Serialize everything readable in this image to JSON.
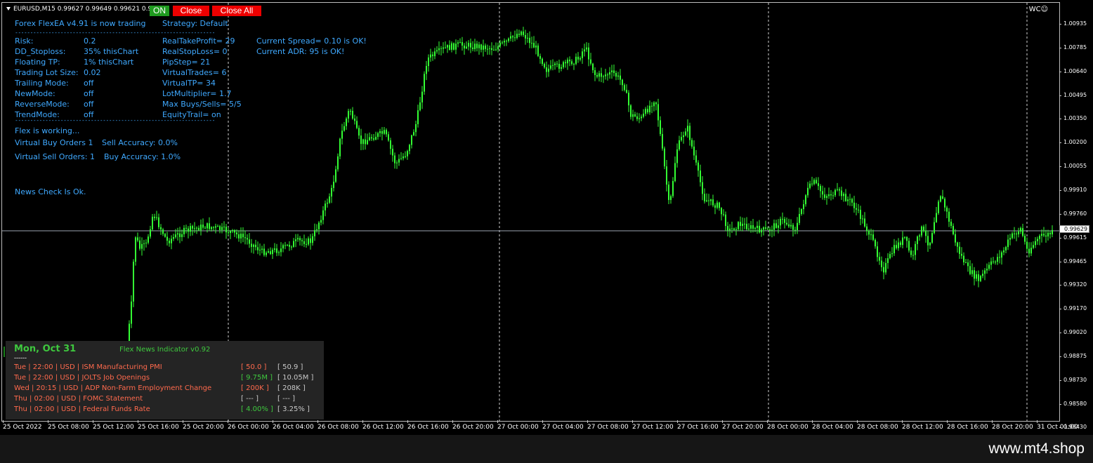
{
  "symbol_info": "EURUSD,M15  0.99627 0.99649 0.99621 0.99",
  "buttons": {
    "on": "ON",
    "close": "Close",
    "close_all": "Close All"
  },
  "wc_label": "WC",
  "ea_panel": {
    "trading_status": "Forex FlexEA v4.91 is now trading",
    "strategy": "Strategy: Default",
    "separator": "------------------------------------------------------------------",
    "rows": [
      {
        "label": "Risk:",
        "value": "0.2",
        "mid": "RealTakeProfit= 29",
        "right": "Current Spread= 0.10 is OK!"
      },
      {
        "label": "DD_Stoploss:",
        "value": "35%  thisChart",
        "mid": "RealStopLoss= 0",
        "right": "Current ADR: 95  is OK!"
      },
      {
        "label": "Floating TP:",
        "value": "1%  thisChart",
        "mid": "PipStep= 21",
        "right": ""
      },
      {
        "label": "Trading Lot Size:",
        "value": "0.02",
        "mid": "VirtualTrades= 6",
        "right": ""
      },
      {
        "label": "Trailing Mode:",
        "value": "off",
        "mid": "VirtualTP= 34",
        "right": ""
      },
      {
        "label": "NewMode:",
        "value": "off",
        "mid": "LotMultiplier= 1.7",
        "right": ""
      },
      {
        "label": "ReverseMode:",
        "value": "off",
        "mid": "Max Buys/Sells= 5/5",
        "right": ""
      },
      {
        "label": "TrendMode:",
        "value": "off",
        "mid": "EquityTrail= on",
        "right": ""
      }
    ],
    "working": "Flex is working...",
    "virtual_buy": "Virtual Buy Orders 1",
    "sell_accuracy": "Sell Accuracy: 0.0%",
    "virtual_sell": "Virtual Sell Orders: 1",
    "buy_accuracy": "Buy Accuracy: 1.0%",
    "news_check": "News Check Is Ok."
  },
  "price_axis": [
    "1.00935",
    "1.00785",
    "1.00640",
    "1.00495",
    "1.00350",
    "1.00200",
    "1.00055",
    "0.99910",
    "0.99760",
    "0.99615",
    "0.99465",
    "0.99320",
    "0.99170",
    "0.99020",
    "0.98875",
    "0.98730",
    "0.98580",
    "0.98430"
  ],
  "current_price": "0.99629",
  "time_axis": [
    "25 Oct 2022",
    "25 Oct 08:00",
    "25 Oct 12:00",
    "25 Oct 16:00",
    "25 Oct 20:00",
    "26 Oct 00:00",
    "26 Oct 04:00",
    "26 Oct 08:00",
    "26 Oct 12:00",
    "26 Oct 16:00",
    "26 Oct 20:00",
    "27 Oct 00:00",
    "27 Oct 04:00",
    "27 Oct 08:00",
    "27 Oct 12:00",
    "27 Oct 16:00",
    "27 Oct 20:00",
    "28 Oct 00:00",
    "28 Oct 04:00",
    "28 Oct 08:00",
    "28 Oct 12:00",
    "28 Oct 16:00",
    "28 Oct 20:00",
    "31 Oct 01:00"
  ],
  "news": {
    "date": "Mon, Oct 31",
    "indicator": "Flex News Indicator v0.92",
    "dashes": "------",
    "events": [
      {
        "text": "Tue  |  22:00  |  USD  |  ISM Manufacturing PMI",
        "actual": "[ 50.0 ]",
        "actual_color": "red",
        "prev": "[ 50.9 ]"
      },
      {
        "text": "Tue  |  22:00  |  USD  |  JOLTS Job Openings",
        "actual": "[ 9.75M ]",
        "actual_color": "green",
        "prev": "[ 10.05M ]"
      },
      {
        "text": "Wed  |  20:15  |  USD  |  ADP Non-Farm Employment Change",
        "actual": "[ 200K ]",
        "actual_color": "red",
        "prev": "[ 208K ]"
      },
      {
        "text": "Thu  |  02:00  |  USD  |  FOMC Statement",
        "actual": "[ --- ]",
        "actual_color": "gray",
        "prev": "[ --- ]"
      },
      {
        "text": "Thu  |  02:00  |  USD  |  Federal Funds Rate",
        "actual": "[ 4.00% ]",
        "actual_color": "green",
        "prev": "[ 3.25% ]"
      }
    ]
  },
  "brand": "www.mt4.shop",
  "colors": {
    "candle": "#33ff33",
    "ea_text": "#3fa9ff",
    "button_on": "#1f9b1f",
    "button_close": "#ee0000"
  }
}
